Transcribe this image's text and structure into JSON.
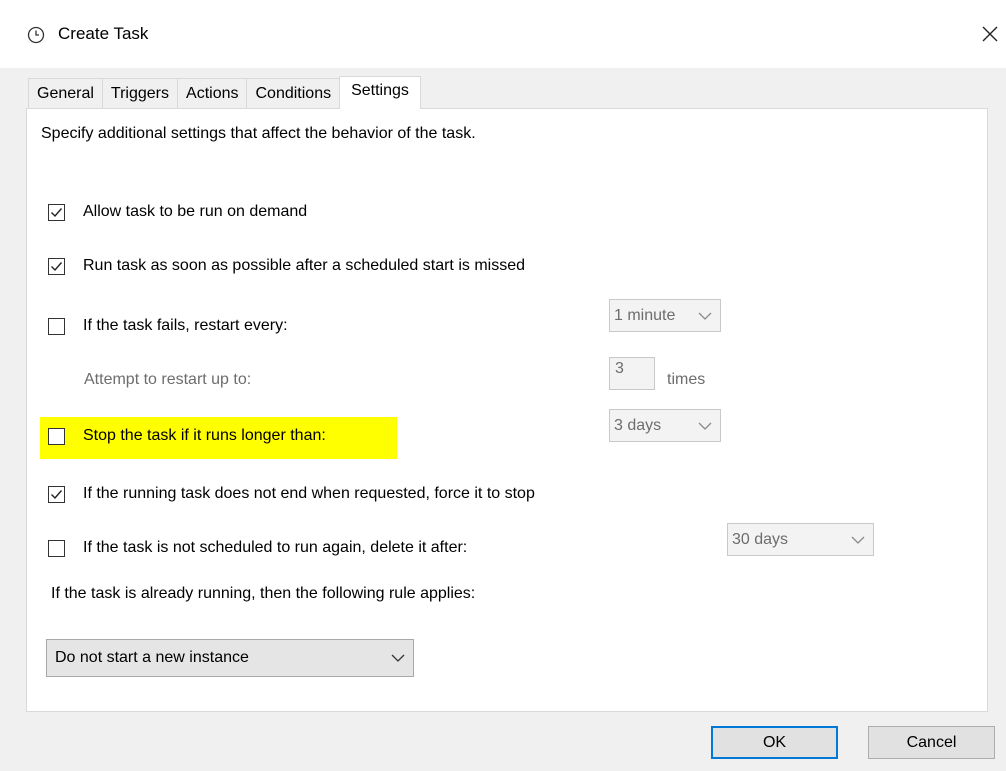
{
  "window": {
    "title": "Create Task",
    "icon": "clock-icon",
    "close_icon": "close-icon"
  },
  "tabs": [
    {
      "label": "General",
      "active": false
    },
    {
      "label": "Triggers",
      "active": false
    },
    {
      "label": "Actions",
      "active": false
    },
    {
      "label": "Conditions",
      "active": false
    },
    {
      "label": "Settings",
      "active": true
    }
  ],
  "settings": {
    "description": "Specify additional settings that affect the behavior of the task.",
    "allow_on_demand": {
      "label": "Allow task to be run on demand",
      "checked": true
    },
    "run_asap": {
      "label": "Run task as soon as possible after a scheduled start is missed",
      "checked": true
    },
    "restart_every": {
      "label": "If the task fails, restart every:",
      "checked": false,
      "value": "1 minute"
    },
    "restart_attempts": {
      "label": "Attempt to restart up to:",
      "value": "3",
      "unit": "times"
    },
    "stop_if_longer": {
      "label": "Stop the task if it runs longer than:",
      "checked": false,
      "value": "3 days",
      "highlight_color": "#ffff00"
    },
    "force_stop": {
      "label": "If the running task does not end when requested, force it to stop",
      "checked": true
    },
    "delete_after": {
      "label": "If the task is not scheduled to run again, delete it after:",
      "checked": false,
      "value": "30 days"
    },
    "rule_label": "If the task is already running, then the following rule applies:",
    "rule_value": "Do not start a new instance"
  },
  "buttons": {
    "ok": "OK",
    "cancel": "Cancel"
  },
  "colors": {
    "accent": "#0078d7",
    "highlight": "#ffff00"
  }
}
